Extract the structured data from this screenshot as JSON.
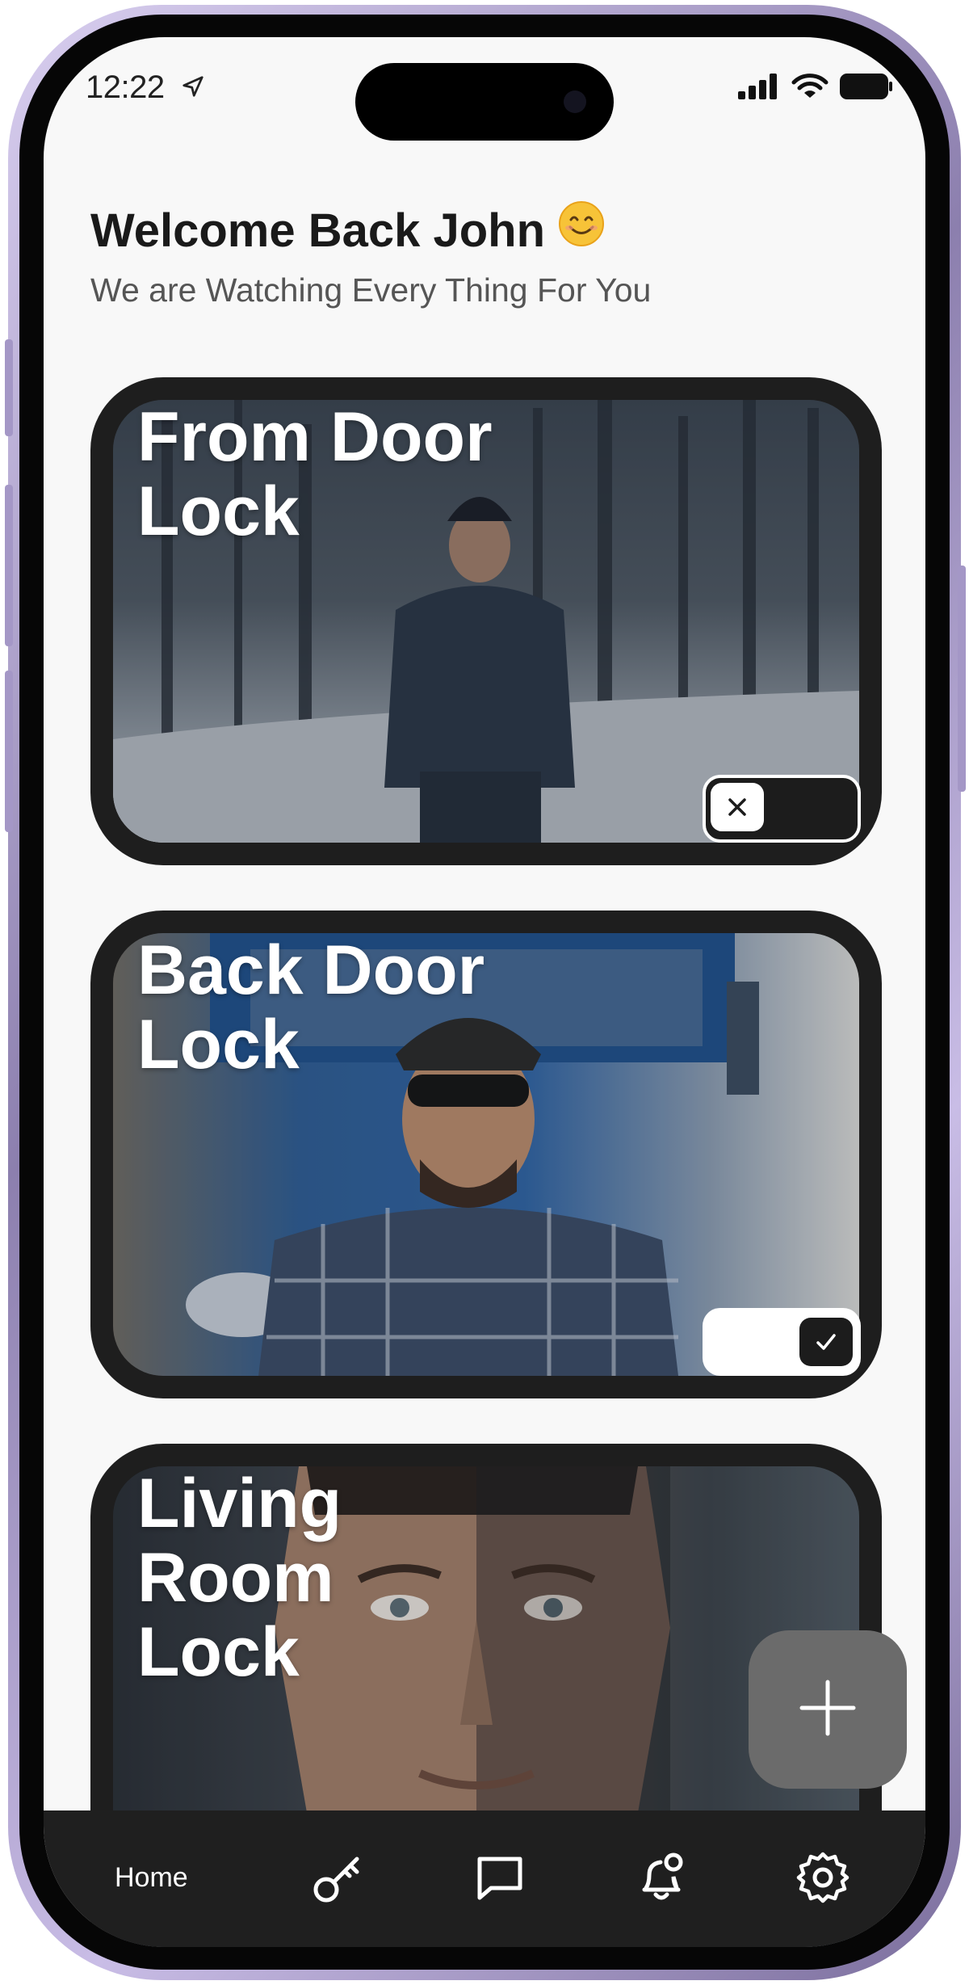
{
  "status_bar": {
    "time": "12:22",
    "icons": [
      "location-arrow-icon",
      "cellular-signal-icon",
      "wifi-icon",
      "battery-icon"
    ]
  },
  "greeting": {
    "title": "Welcome Back John",
    "emoji": "smiling-face-emoji",
    "subtitle": "We are Watching Every Thing For You"
  },
  "locks": [
    {
      "title_line1": "From Door",
      "title_line2": "Lock",
      "title_line3": "",
      "state": "off"
    },
    {
      "title_line1": "Back Door",
      "title_line2": "Lock",
      "title_line3": "",
      "state": "on"
    },
    {
      "title_line1": "Living",
      "title_line2": "Room",
      "title_line3": "Lock",
      "state": null
    }
  ],
  "fab": {
    "icon": "plus-icon"
  },
  "bottom_nav": {
    "home_label": "Home",
    "items": [
      "key-icon",
      "chat-icon",
      "notification-bell-icon",
      "settings-gear-icon"
    ]
  },
  "colors": {
    "card_background": "#1e1e1e",
    "screen_background": "#f8f8f8",
    "nav_background": "#1f1f1f",
    "fab_background": "#6b6b6b",
    "phone_frame": "#b8aedb"
  }
}
